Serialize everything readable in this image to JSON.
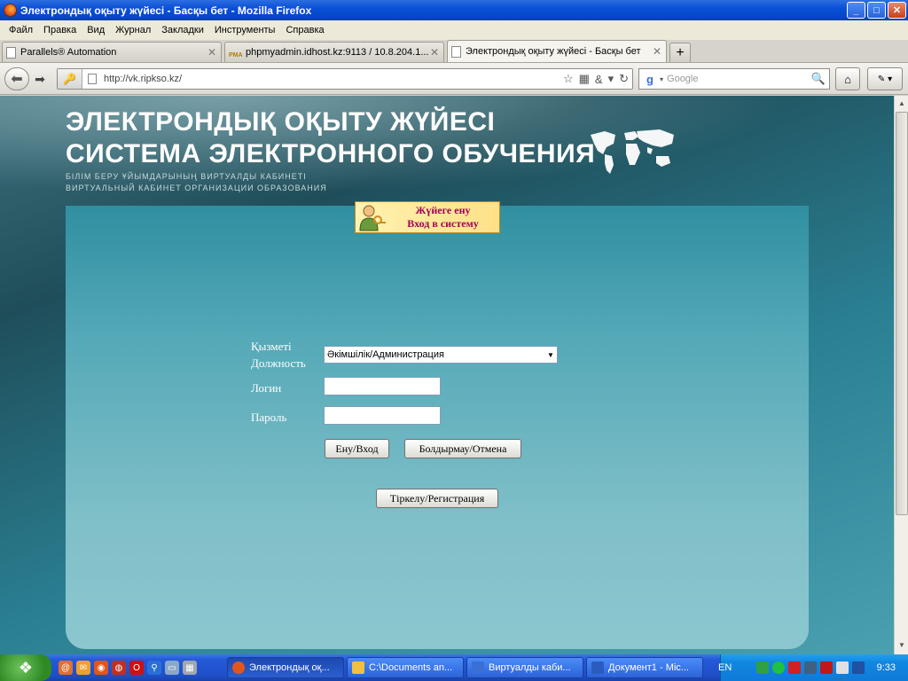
{
  "window": {
    "title": "Электрондық оқыту жүйесі - Басқы бет - Mozilla Firefox",
    "min_label": "_",
    "max_label": "□",
    "close_label": "✕"
  },
  "menu": {
    "items": [
      "Файл",
      "Правка",
      "Вид",
      "Журнал",
      "Закладки",
      "Инструменты",
      "Справка"
    ]
  },
  "tabs": [
    {
      "label": "Parallels® Automation",
      "active": false
    },
    {
      "label": "phpmyadmin.idhost.kz:9113 / 10.8.204.1...",
      "active": false
    },
    {
      "label": "Электрондық оқыту жүйесі - Басқы бет",
      "active": true
    }
  ],
  "tab_close": "✕",
  "newtab_label": "+",
  "nav": {
    "url": "http://vk.ripkso.kz/",
    "search_placeholder": "Google",
    "search_engine_letter": "g"
  },
  "page": {
    "header_kz": "ЭЛЕКТРОНДЫҚ ОҚЫТУ ЖҮЙЕСІ",
    "header_ru": "СИСТЕМА ЭЛЕКТРОННОГО ОБУЧЕНИЯ",
    "sub_kz": "БІЛІМ БЕРУ ҰЙЫМДАРЫНЫҢ ВИРТУАЛДЫ КАБИНЕТІ",
    "sub_ru": "ВИРТУАЛЬНЫЙ КАБИНЕТ ОРГАНИЗАЦИИ ОБРАЗОВАНИЯ",
    "login_badge_kz": "Жүйеге ену",
    "login_badge_ru": "Вход в систему",
    "position_label_kz": "Қызметі",
    "position_label_ru": "Должность",
    "position_value": "Әкімшілік/Администрация",
    "login_label": "Логин",
    "password_label": "Пароль",
    "login_value": "",
    "password_value": "",
    "enter_button": "Ену/Вход",
    "cancel_button": "Болдырмау/Отмена",
    "register_button": "Тіркелу/Регистрация"
  },
  "taskbar": {
    "tasks": [
      {
        "label": "Электрондық оқ...",
        "active": true,
        "color": "#e2561c"
      },
      {
        "label": "C:\\Documents an...",
        "active": false,
        "color": "#f0c040"
      },
      {
        "label": "Виртуалды каби...",
        "active": false,
        "color": "#3a6fd8"
      },
      {
        "label": "Документ1 - Mic...",
        "active": false,
        "color": "#2a5cc0"
      }
    ],
    "language": "EN",
    "clock": "9:33"
  }
}
